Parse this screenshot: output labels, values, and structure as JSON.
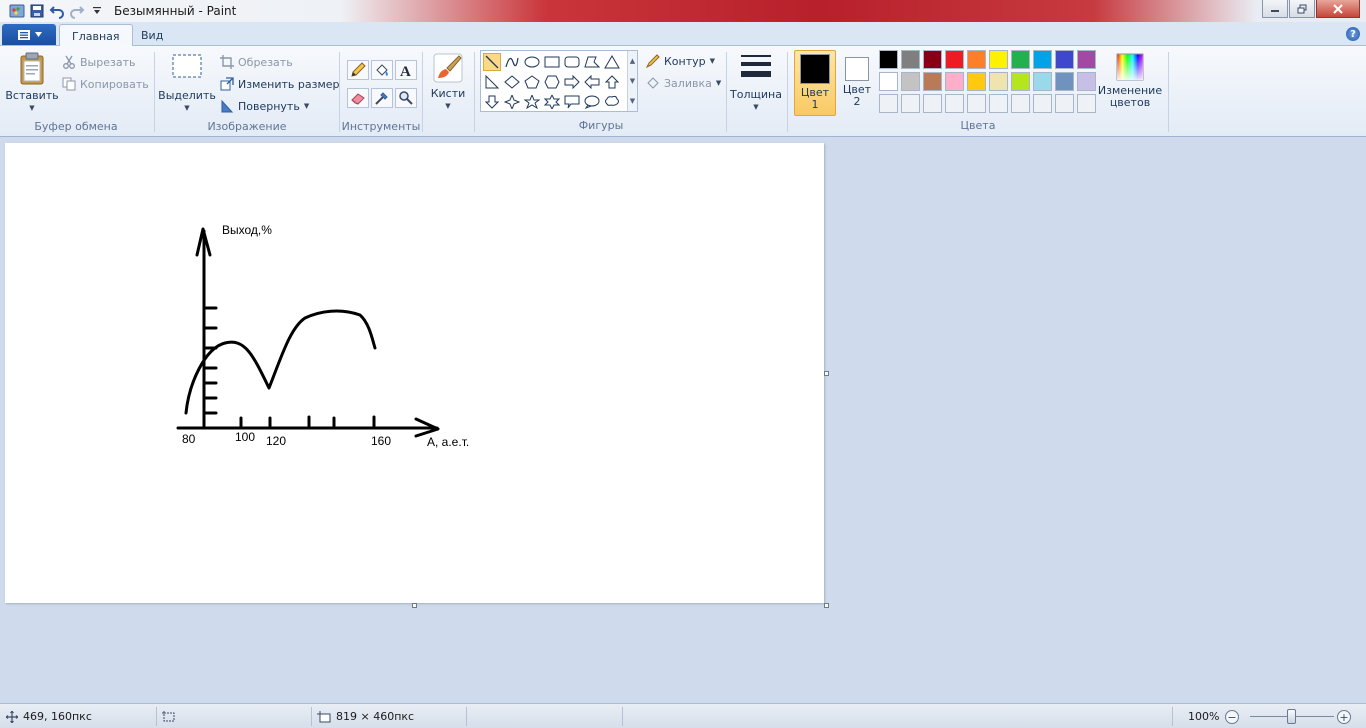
{
  "window": {
    "title": "Безымянный - Paint",
    "controls": [
      "minimize",
      "maximize",
      "close"
    ]
  },
  "tabs": [
    {
      "label": "Главная",
      "active": true
    },
    {
      "label": "Вид",
      "active": false
    }
  ],
  "ribbon": {
    "clipboard": {
      "paste": "Вставить",
      "cut": "Вырезать",
      "copy": "Копировать",
      "label": "Буфер обмена"
    },
    "image": {
      "select": "Выделить",
      "crop": "Обрезать",
      "resize": "Изменить размер",
      "rotate": "Повернуть",
      "label": "Изображение"
    },
    "tools": {
      "label": "Инструменты",
      "items": [
        "pencil-icon",
        "fill-icon",
        "text-icon",
        "eraser-icon",
        "color-picker-icon",
        "magnifier-icon"
      ]
    },
    "brushes": {
      "label": "Кисти"
    },
    "shapes": {
      "label": "Фигуры",
      "outline": "Контур",
      "fill": "Заливка",
      "selected": "line"
    },
    "size": {
      "label": "Толщина"
    },
    "colors": {
      "color1_label": "Цвет",
      "color1_num": "1",
      "color2_label": "Цвет",
      "color2_num": "2",
      "color1": "#000000",
      "color2": "#ffffff",
      "edit_label_1": "Изменение",
      "edit_label_2": "цветов",
      "label": "Цвета",
      "palette_row1": [
        "#000000",
        "#7f7f7f",
        "#880015",
        "#ed1c24",
        "#ff7f27",
        "#fff200",
        "#22b14c",
        "#00a2e8",
        "#3f48cc",
        "#a349a4"
      ],
      "palette_row2": [
        "#ffffff",
        "#c3c3c3",
        "#b97a57",
        "#ffaec9",
        "#ffc90e",
        "#efe4b0",
        "#b5e61d",
        "#99d9ea",
        "#7092be",
        "#c8bfe7"
      ],
      "palette_row3_empty": 10
    }
  },
  "canvas_text": {
    "ylabel": "Выход,%",
    "xlabel": "A, а.е.т.",
    "tick_80": "80",
    "tick_100": "100",
    "tick_120": "120",
    "tick_160": "160"
  },
  "statusbar": {
    "cursor_pos": "469, 160пкс",
    "selection_size": "",
    "image_size": "819 × 460пкс",
    "zoom": "100%",
    "zoom_minus": "−",
    "zoom_plus": "+"
  }
}
